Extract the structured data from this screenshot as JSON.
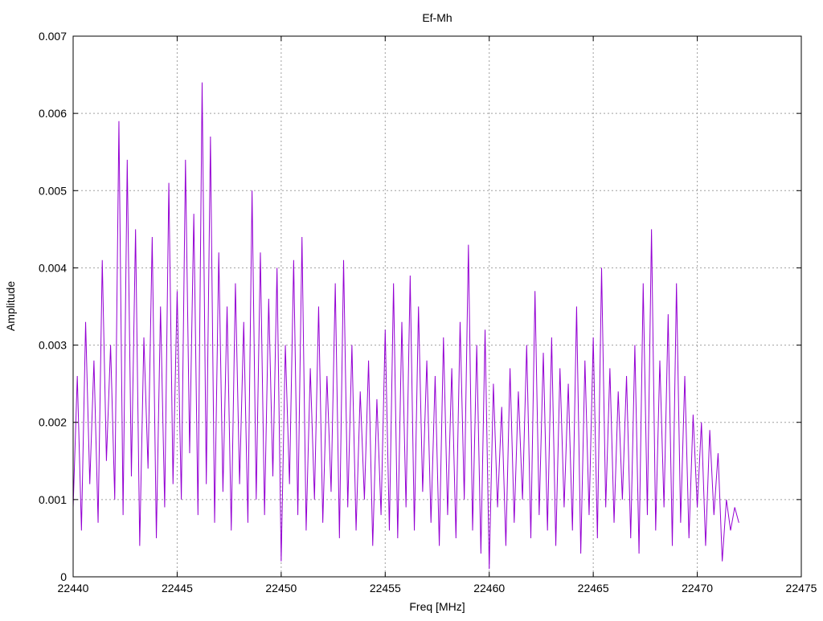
{
  "chart_data": {
    "type": "line",
    "title": "Ef-Mh",
    "xlabel": "Freq [MHz]",
    "ylabel": "Amplitude",
    "xlim": [
      22440,
      22475
    ],
    "ylim": [
      0,
      0.007
    ],
    "grid": true,
    "xticks": [
      "22440",
      "22445",
      "22450",
      "22455",
      "22460",
      "22465",
      "22470",
      "22475"
    ],
    "yticks": [
      "0",
      "0.001",
      "0.002",
      "0.003",
      "0.004",
      "0.005",
      "0.006",
      "0.007"
    ],
    "series": [
      {
        "name": "Ef-Mh",
        "color": "#9400d3",
        "x_start": 22440,
        "x_step": 0.2,
        "values": [
          0.0009,
          0.0026,
          0.0006,
          0.0033,
          0.0012,
          0.0028,
          0.0007,
          0.0041,
          0.0015,
          0.003,
          0.001,
          0.0059,
          0.0008,
          0.0054,
          0.0013,
          0.0045,
          0.0004,
          0.0031,
          0.0014,
          0.0044,
          0.0005,
          0.0035,
          0.0009,
          0.0051,
          0.0012,
          0.0037,
          0.001,
          0.0054,
          0.0016,
          0.0047,
          0.0008,
          0.0064,
          0.0012,
          0.0057,
          0.0007,
          0.0042,
          0.0011,
          0.0035,
          0.0006,
          0.0038,
          0.0012,
          0.0033,
          0.0007,
          0.005,
          0.001,
          0.0042,
          0.0008,
          0.0036,
          0.0013,
          0.004,
          0.0002,
          0.003,
          0.0012,
          0.0041,
          0.0008,
          0.0044,
          0.0006,
          0.0027,
          0.001,
          0.0035,
          0.0007,
          0.0026,
          0.0011,
          0.0038,
          0.0005,
          0.0041,
          0.0009,
          0.003,
          0.0006,
          0.0024,
          0.001,
          0.0028,
          0.0004,
          0.0023,
          0.0008,
          0.0032,
          0.0006,
          0.0038,
          0.0005,
          0.0033,
          0.0009,
          0.0039,
          0.0006,
          0.0035,
          0.0011,
          0.0028,
          0.0007,
          0.0026,
          0.0004,
          0.0031,
          0.0008,
          0.0027,
          0.0005,
          0.0033,
          0.001,
          0.0043,
          0.0006,
          0.003,
          0.0003,
          0.0032,
          0.0001,
          0.0025,
          0.0009,
          0.0022,
          0.0004,
          0.0027,
          0.0007,
          0.0024,
          0.001,
          0.003,
          0.0005,
          0.0037,
          0.0008,
          0.0029,
          0.0006,
          0.0031,
          0.0004,
          0.0027,
          0.0009,
          0.0025,
          0.0006,
          0.0035,
          0.0003,
          0.0028,
          0.0008,
          0.0031,
          0.0005,
          0.004,
          0.0009,
          0.0027,
          0.0007,
          0.0024,
          0.001,
          0.0026,
          0.0005,
          0.003,
          0.0003,
          0.0038,
          0.0008,
          0.0045,
          0.0006,
          0.0028,
          0.0009,
          0.0034,
          0.0004,
          0.0038,
          0.0007,
          0.0026,
          0.0005,
          0.0021,
          0.0009,
          0.002,
          0.0004,
          0.0019,
          0.0008,
          0.0016,
          0.0002,
          0.001,
          0.0006,
          0.0009,
          0.0007
        ]
      }
    ]
  }
}
